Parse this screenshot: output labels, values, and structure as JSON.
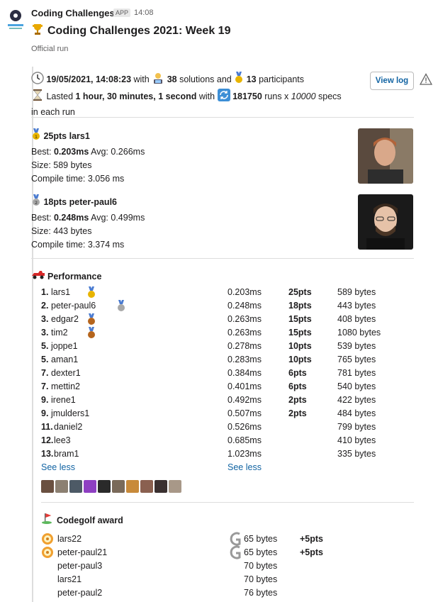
{
  "app": {
    "name": "Coding Challenges",
    "badge": "APP",
    "time": "14:08"
  },
  "message": {
    "title": "Coding Challenges 2021: Week 19",
    "subtitle": "Official run"
  },
  "summary": {
    "datetime": "19/05/2021, 14:08:23",
    "with": " with ",
    "solutions_count": "38",
    "solutions_label": " solutions and ",
    "participants_count": "13",
    "participants_label": " participants",
    "lasted_label": "Lasted ",
    "duration": "1 hour, 30 minutes, 1 second",
    "with2": " with ",
    "runs": "181750",
    "runs_x": " runs x ",
    "specs": "10000",
    "specs_label": " specs",
    "in_each_run": "in each run"
  },
  "actions": {
    "view_log": "View log"
  },
  "winners": [
    {
      "title": "25pts lars1",
      "best_label": "Best: ",
      "best": "0.203ms",
      "avg": " Avg: 0.266ms",
      "size": "Size: 589 bytes",
      "compile": "Compile time: 3.056 ms",
      "medal": "gold"
    },
    {
      "title": "18pts peter-paul6",
      "best_label": "Best: ",
      "best": "0.248ms",
      "avg": " Avg: 0.499ms",
      "size": "Size: 443 bytes",
      "compile": "Compile time: 3.374 ms",
      "medal": "silver"
    }
  ],
  "performance": {
    "heading": "Performance",
    "rows": [
      {
        "rank": "1.",
        "name": "lars1",
        "time": "0.203ms",
        "pts": "25pts",
        "size": "589 bytes",
        "medal": "gold"
      },
      {
        "rank": "2.",
        "name": "peter-paul6",
        "time": "0.248ms",
        "pts": "18pts",
        "size": "443 bytes",
        "medal": "silver"
      },
      {
        "rank": "3.",
        "name": "edgar2",
        "time": "0.263ms",
        "pts": "15pts",
        "size": "408 bytes",
        "medal": "bronze"
      },
      {
        "rank": "3.",
        "name": "tim2",
        "time": "0.263ms",
        "pts": "15pts",
        "size": "1080 bytes",
        "medal": "bronze"
      },
      {
        "rank": "5.",
        "name": "joppe1",
        "time": "0.278ms",
        "pts": "10pts",
        "size": "539 bytes",
        "medal": ""
      },
      {
        "rank": "5.",
        "name": "aman1",
        "time": "0.283ms",
        "pts": "10pts",
        "size": "765 bytes",
        "medal": ""
      },
      {
        "rank": "7.",
        "name": "dexter1",
        "time": "0.384ms",
        "pts": "6pts",
        "size": "781 bytes",
        "medal": ""
      },
      {
        "rank": "7.",
        "name": "mettin2",
        "time": "0.401ms",
        "pts": "6pts",
        "size": "540 bytes",
        "medal": ""
      },
      {
        "rank": "9.",
        "name": "irene1",
        "time": "0.492ms",
        "pts": "2pts",
        "size": "422 bytes",
        "medal": ""
      },
      {
        "rank": "9.",
        "name": "jmulders1",
        "time": "0.507ms",
        "pts": "2pts",
        "size": "484 bytes",
        "medal": ""
      },
      {
        "rank": "11.",
        "name": "daniel2",
        "time": "0.526ms",
        "pts": "",
        "size": "799 bytes",
        "medal": ""
      },
      {
        "rank": "12.",
        "name": "lee3",
        "time": "0.685ms",
        "pts": "",
        "size": "410 bytes",
        "medal": ""
      },
      {
        "rank": "13.",
        "name": "bram1",
        "time": "1.023ms",
        "pts": "",
        "size": "335 bytes",
        "medal": ""
      }
    ],
    "see_less_left": "See less",
    "see_less_right": "See less"
  },
  "codegolf": {
    "heading": "Codegolf award",
    "rows": [
      {
        "name": "lars22",
        "size": "65 bytes",
        "pts": "+5pts",
        "award": true
      },
      {
        "name": "peter-paul21",
        "size": "65 bytes",
        "pts": "+5pts",
        "award": true
      },
      {
        "name": "peter-paul3",
        "size": "70 bytes",
        "pts": "",
        "award": false
      },
      {
        "name": "lars21",
        "size": "70 bytes",
        "pts": "",
        "award": false
      },
      {
        "name": "peter-paul2",
        "size": "76 bytes",
        "pts": "",
        "award": false
      }
    ]
  },
  "colors": {
    "link": "#1264a3",
    "gold": "#e8b400",
    "silver": "#a8a8a8",
    "bronze": "#b5651d",
    "muted": "#616061"
  }
}
